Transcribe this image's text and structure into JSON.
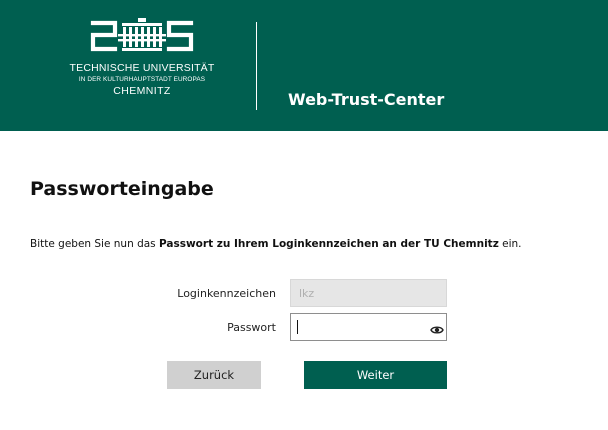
{
  "header": {
    "logo": {
      "line1": "TECHNISCHE UNIVERSITÄT",
      "line2": "IN DER KULTURHAUPTSTADT EUROPAS",
      "line3": "CHEMNITZ"
    },
    "site_title": "Web-Trust-Center"
  },
  "main": {
    "title": "Passworteingabe",
    "instruction": {
      "prefix": "Bitte geben Sie nun das ",
      "bold": "Passwort zu Ihrem Loginkennzeichen an der TU Chemnitz",
      "suffix": " ein."
    },
    "form": {
      "login": {
        "label": "Loginkennzeichen",
        "placeholder": "lkz",
        "value": ""
      },
      "password": {
        "label": "Passwort",
        "value": "",
        "toggle_icon": "eye-icon"
      },
      "back_label": "Zurück",
      "next_label": "Weiter"
    }
  },
  "colors": {
    "brand": "#005f50",
    "secondary_button": "#d0d0d0",
    "disabled_input": "#e6e6e6"
  }
}
